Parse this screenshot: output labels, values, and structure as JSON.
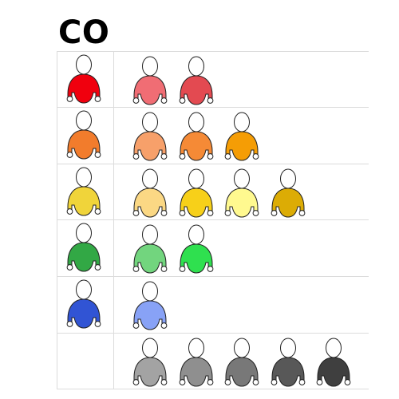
{
  "title": "CO",
  "rows": [
    {
      "name": "red",
      "lead": "#f0000e",
      "members": [
        "#f06d74",
        "#e34a51"
      ]
    },
    {
      "name": "orange",
      "lead": "#f27c2c",
      "members": [
        "#f7a06a",
        "#f58a36",
        "#f59d05"
      ]
    },
    {
      "name": "yellow",
      "lead": "#f0d43a",
      "members": [
        "#fbd884",
        "#f7d019",
        "#fff98f",
        "#dcac05"
      ]
    },
    {
      "name": "green",
      "lead": "#32a845",
      "members": [
        "#72d57e",
        "#2fe04f"
      ]
    },
    {
      "name": "blue",
      "lead": "#3154d4",
      "members": [
        "#88a2f6"
      ]
    },
    {
      "name": "gray",
      "lead": null,
      "members": [
        "#a3a3a3",
        "#8f8f8f",
        "#787878",
        "#585858",
        "#3f3f3f"
      ]
    }
  ]
}
